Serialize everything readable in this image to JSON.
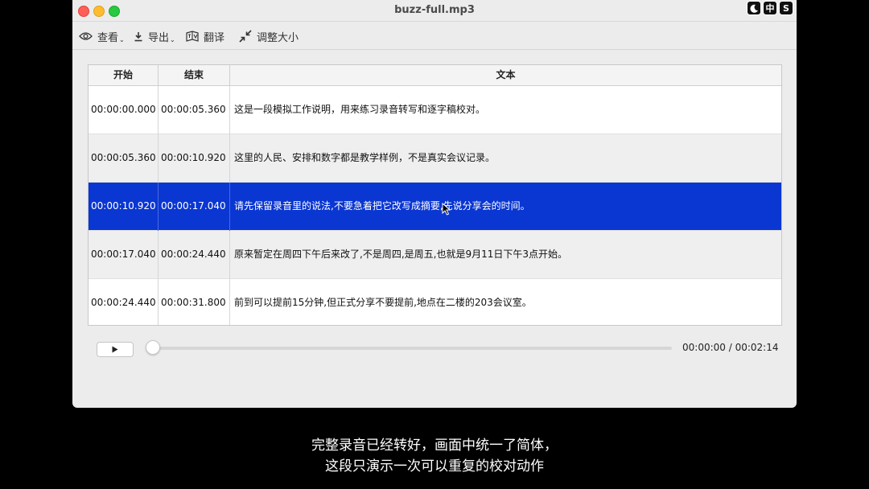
{
  "window": {
    "title": "buzz-full.mp3"
  },
  "toolbar": {
    "items": [
      {
        "label": "查看",
        "icon": "eye-icon",
        "has_menu": true
      },
      {
        "label": "导出",
        "icon": "download-icon",
        "has_menu": true
      },
      {
        "label": "翻译",
        "icon": "translate-icon",
        "has_menu": false
      },
      {
        "label": "调整大小",
        "icon": "resize-icon",
        "has_menu": false
      }
    ]
  },
  "table": {
    "headers": {
      "start": "开始",
      "end": "结束",
      "text": "文本"
    },
    "rows": [
      {
        "start": "00:00:00.000",
        "end": "00:00:05.360",
        "text": "这是一段模拟工作说明，用来练习录音转写和逐字稿校对。",
        "selected": false
      },
      {
        "start": "00:00:05.360",
        "end": "00:00:10.920",
        "text": "这里的人民、安排和数字都是教学样例，不是真实会议记录。",
        "selected": false
      },
      {
        "start": "00:00:10.920",
        "end": "00:00:17.040",
        "text": "请先保留录音里的说法,不要急着把它改写成摘要,先说分享会的时间。",
        "selected": true
      },
      {
        "start": "00:00:17.040",
        "end": "00:00:24.440",
        "text": "原来暂定在周四下午后来改了,不是周四,是周五,也就是9月11日下午3点开始。",
        "selected": false
      },
      {
        "start": "00:00:24.440",
        "end": "00:00:31.800",
        "text": "前到可以提前15分钟,但正式分享不要提前,地点在二楼的203会议室。",
        "selected": false
      }
    ],
    "selected_color": "#0a36d2"
  },
  "player": {
    "time_display": "00:00:00 / 00:02:14",
    "progress": 0
  },
  "overlay": {
    "icons": [
      "moon-icon",
      "中",
      "S"
    ]
  },
  "subtitles": {
    "line1": "完整录音已经转好，画面中统一了简体，",
    "line2": "这段只演示一次可以重复的校对动作"
  }
}
